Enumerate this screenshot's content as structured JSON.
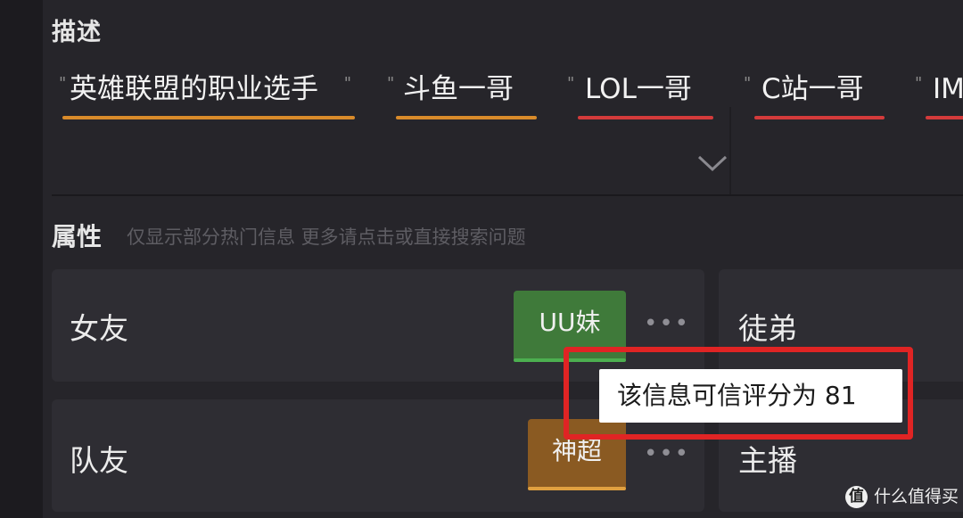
{
  "description": {
    "title": "描述",
    "tags": [
      {
        "label": "英雄联盟的职业选手",
        "underline_color": "#d98b2a"
      },
      {
        "label": "斗鱼一哥",
        "underline_color": "#d98b2a"
      },
      {
        "label": "LOL一哥",
        "underline_color": "#d43b3b"
      },
      {
        "label": "C站一哥",
        "underline_color": "#d43b3b"
      },
      {
        "label": "IM",
        "underline_color": "#d43b3b"
      }
    ],
    "expand_icon": "chevron-down-icon"
  },
  "attributes": {
    "title": "属性",
    "hint": "仅显示部分热门信息  更多请点击或直接搜索问题",
    "cards": [
      {
        "label": "女友",
        "value": "UU妹",
        "value_color": "#3f7a3a",
        "bar_color": "#4caf50",
        "more": "•••"
      },
      {
        "label": "徒弟"
      },
      {
        "label": "队友",
        "value": "神超",
        "value_color": "#8a5a22",
        "bar_color": "#e0a040",
        "more": "•••"
      },
      {
        "label": "主播"
      }
    ]
  },
  "tooltip": {
    "text": "该信息可信评分为 81"
  },
  "highlight_color": "#e02424",
  "watermark": {
    "logo": "值",
    "text": "什么值得买"
  }
}
